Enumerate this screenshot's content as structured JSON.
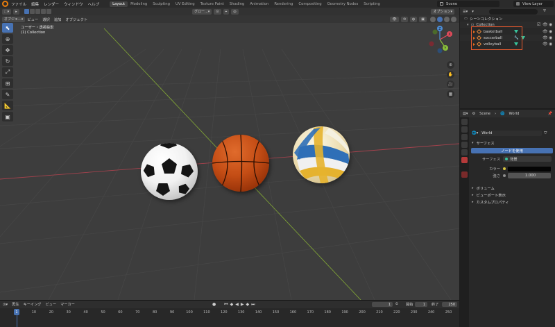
{
  "menubar": {
    "items": [
      "ファイル",
      "編集",
      "レンダー",
      "ウィンドウ",
      "ヘルプ"
    ],
    "workspaces": [
      "Layout",
      "Modeling",
      "Sculpting",
      "UV Editing",
      "Texture Paint",
      "Shading",
      "Animation",
      "Rendering",
      "Compositing",
      "Geometry Nodes",
      "Scripting"
    ],
    "active_workspace": "Layout",
    "scene": "Scene",
    "view_layer": "View Layer"
  },
  "viewport": {
    "mode": "オブジェ...",
    "menus": [
      "ビュー",
      "選択",
      "追加",
      "オブジェクト"
    ],
    "transform": "グロー...",
    "options": "オプション",
    "view_name": "ユーザー・透視投影",
    "collection_info": "(1) Collection",
    "gizmo": {
      "x": "X",
      "y": "Y",
      "z": "Z"
    }
  },
  "timeline": {
    "menus": [
      "再生",
      "キーイング",
      "ビュー",
      "マーカー"
    ],
    "current_frame": "1",
    "start_label": "開始",
    "start": "1",
    "end_label": "終了",
    "end": "250",
    "ticks": [
      "0",
      "10",
      "20",
      "30",
      "40",
      "50",
      "60",
      "70",
      "80",
      "90",
      "100",
      "110",
      "120",
      "130",
      "140",
      "150",
      "160",
      "170",
      "180",
      "190",
      "200",
      "210",
      "220",
      "230",
      "240",
      "250"
    ]
  },
  "outliner": {
    "scene_collection": "シーンコレクション",
    "collection": "Collection",
    "objects": [
      {
        "name": "basketball"
      },
      {
        "name": "soccerball"
      },
      {
        "name": "volleyball"
      }
    ],
    "highlight_color": "#e85a2e"
  },
  "properties": {
    "breadcrumb": [
      "Scene",
      "World"
    ],
    "world_name": "World",
    "surface_panel": "サーフェス",
    "use_nodes": "ノードを使用",
    "surface_label": "サーフェス",
    "surface_value": "背景",
    "color_label": "カラー",
    "strength_label": "強さ",
    "strength_value": "1.000",
    "panels": [
      "ボリューム",
      "ビューポート表示",
      "カスタムプロパティ"
    ]
  },
  "theme": {
    "accent": "#4772b3",
    "x_axis": "#e04b5b",
    "y_axis": "#8ac13a",
    "z_axis": "#4c8ed8"
  }
}
